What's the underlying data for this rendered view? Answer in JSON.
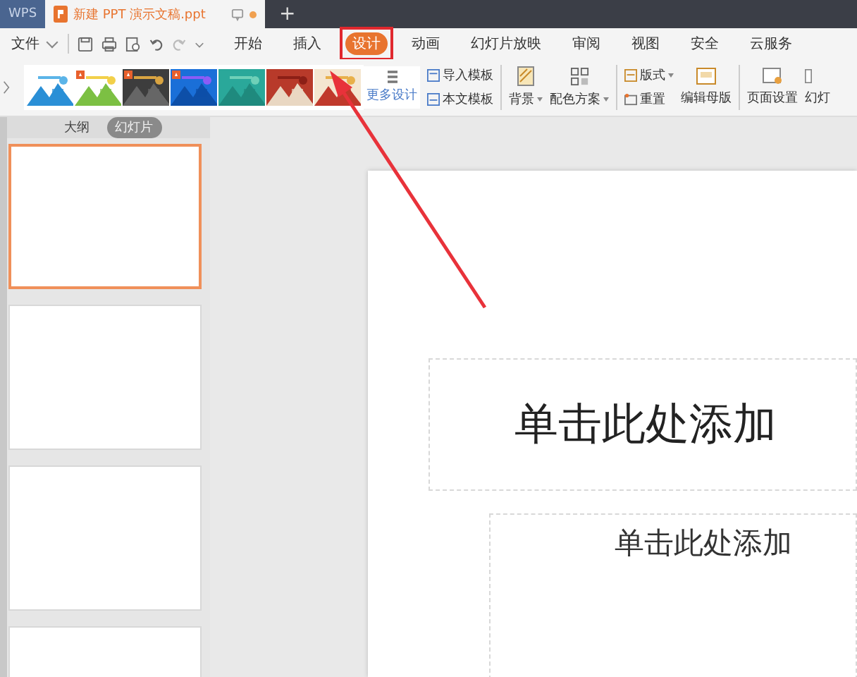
{
  "title_bar": {
    "app_tab": "WPS",
    "document_tab": {
      "title": "新建 PPT 演示文稿.ppt"
    },
    "new_tab": "+"
  },
  "menu": {
    "file": "文件",
    "tabs": [
      {
        "label": "开始",
        "selected": false,
        "highlighted": false
      },
      {
        "label": "插入",
        "selected": false,
        "highlighted": false
      },
      {
        "label": "设计",
        "selected": true,
        "highlighted": true
      },
      {
        "label": "动画",
        "selected": false,
        "highlighted": false
      },
      {
        "label": "幻灯片放映",
        "selected": false,
        "highlighted": false
      },
      {
        "label": "审阅",
        "selected": false,
        "highlighted": false
      },
      {
        "label": "视图",
        "selected": false,
        "highlighted": false
      },
      {
        "label": "安全",
        "selected": false,
        "highlighted": false
      },
      {
        "label": "云服务",
        "selected": false,
        "highlighted": false
      }
    ]
  },
  "design_toolbar": {
    "templates": [
      {
        "kind": "picture",
        "badge": false
      },
      {
        "kind": "picture",
        "badge": true
      },
      {
        "kind": "picture",
        "badge": true
      },
      {
        "kind": "picture",
        "badge": true
      },
      {
        "kind": "picture",
        "badge": false
      },
      {
        "kind": "picture",
        "badge": false
      },
      {
        "kind": "picture",
        "badge": false
      }
    ],
    "more_design": "更多设计",
    "import_template": "导入模板",
    "this_template": "本文模板",
    "background": "背景",
    "color_scheme": "配色方案",
    "layout": "版式",
    "reset": "重置",
    "edit_master": "编辑母版",
    "page_setup": "页面设置",
    "slide_cut": "幻灯"
  },
  "slide_panel": {
    "tabs": [
      {
        "label": "大纲",
        "selected": false
      },
      {
        "label": "幻灯片",
        "selected": true
      }
    ],
    "slides": [
      {
        "selected": true
      },
      {
        "selected": false
      },
      {
        "selected": false
      },
      {
        "selected": false
      }
    ]
  },
  "slide": {
    "title_placeholder": "单击此处添加",
    "subtitle_placeholder": "单击此处添加"
  }
}
